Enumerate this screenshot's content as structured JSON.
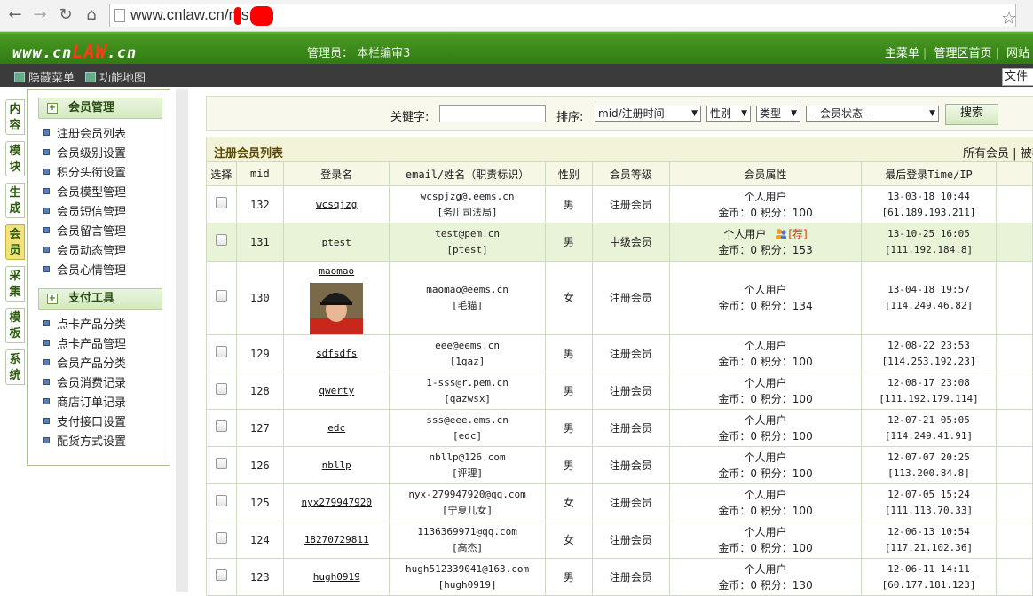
{
  "browser": {
    "url": "www.cnlaw.cn/",
    "url_tail": "ms"
  },
  "header": {
    "logo_prefix": "www.cn",
    "logo_law": "LAW",
    "logo_suffix": ".cn",
    "admin_info": "管理员： 本栏编审3",
    "nav": [
      "主菜单",
      "管理区首页",
      "网站"
    ]
  },
  "toolbar": {
    "hide_menu": "隐藏菜单",
    "function_map": "功能地图",
    "file_select": "文件"
  },
  "vtabs": [
    {
      "label": "内容",
      "active": false
    },
    {
      "label": "模块",
      "active": false
    },
    {
      "label": "生成",
      "active": false
    },
    {
      "label": "会员",
      "active": true
    },
    {
      "label": "采集",
      "active": false
    },
    {
      "label": "模板",
      "active": false
    },
    {
      "label": "系统",
      "active": false
    }
  ],
  "leftmenu": {
    "member_title": "会员管理",
    "member_items": [
      "注册会员列表",
      "会员级别设置",
      "积分头衔设置",
      "会员模型管理",
      "会员短信管理",
      "会员留言管理",
      "会员动态管理",
      "会员心情管理"
    ],
    "payment_title": "支付工具",
    "payment_items": [
      "点卡产品分类",
      "点卡产品管理",
      "会员产品分类",
      "会员消费记录",
      "商店订单记录",
      "支付接口设置",
      "配货方式设置"
    ]
  },
  "search": {
    "keyword_label": "关键字:",
    "keyword_value": "",
    "sort_label": "排序:",
    "sort_value": "mid/注册时间",
    "gender_value": "性别",
    "type_value": "类型",
    "status_value": "—会员状态—",
    "button": "搜索"
  },
  "list": {
    "title": "注册会员列表",
    "filter_all": "所有会员",
    "filter_sep": "|",
    "filter_next": "被荐",
    "columns": [
      "选择",
      "mid",
      "登录名",
      "email/姓名（职责标识）",
      "性别",
      "会员等级",
      "会员属性",
      "最后登录Time/IP"
    ],
    "rows": [
      {
        "mid": "132",
        "login": "wcsqjzg",
        "email": "wcspjzg@.eems.cn",
        "name": "[务川司法局]",
        "gender": "男",
        "level": "注册会员",
        "user_type": "个人用户",
        "points": "金币：0 积分：100",
        "recommended": "",
        "time": "13-03-18 10:44",
        "ip": "[61.189.193.211]",
        "highlight": false,
        "has_avatar": false
      },
      {
        "mid": "131",
        "login": "ptest",
        "email": "test@pem.cn",
        "name": "[ptest]",
        "gender": "男",
        "level": "中级会员",
        "user_type": "个人用户",
        "points": "金币：0 积分：153",
        "recommended": "[荐]",
        "time": "13-10-25 16:05",
        "ip": "[111.192.184.8]",
        "highlight": true,
        "has_avatar": false
      },
      {
        "mid": "130",
        "login": "maomao",
        "email": "maomao@eems.cn",
        "name": "[毛猫]",
        "gender": "女",
        "level": "注册会员",
        "user_type": "个人用户",
        "points": "金币：0 积分：134",
        "recommended": "",
        "time": "13-04-18 19:57",
        "ip": "[114.249.46.82]",
        "highlight": false,
        "has_avatar": true
      },
      {
        "mid": "129",
        "login": "sdfsdfs",
        "email": "eee@eems.cn",
        "name": "[1qaz]",
        "gender": "男",
        "level": "注册会员",
        "user_type": "个人用户",
        "points": "金币：0 积分：100",
        "recommended": "",
        "time": "12-08-22 23:53",
        "ip": "[114.253.192.23]",
        "highlight": false,
        "has_avatar": false
      },
      {
        "mid": "128",
        "login": "qwerty",
        "email": "1-sss@r.pem.cn",
        "name": "[qazwsx]",
        "gender": "男",
        "level": "注册会员",
        "user_type": "个人用户",
        "points": "金币：0 积分：100",
        "recommended": "",
        "time": "12-08-17 23:08",
        "ip": "[111.192.179.114]",
        "highlight": false,
        "has_avatar": false
      },
      {
        "mid": "127",
        "login": "edc",
        "email": "sss@eee.ems.cn",
        "name": "[edc]",
        "gender": "男",
        "level": "注册会员",
        "user_type": "个人用户",
        "points": "金币：0 积分：100",
        "recommended": "",
        "time": "12-07-21 05:05",
        "ip": "[114.249.41.91]",
        "highlight": false,
        "has_avatar": false
      },
      {
        "mid": "126",
        "login": "nbllp",
        "email": "nbllp@126.com",
        "name": "[评理]",
        "gender": "男",
        "level": "注册会员",
        "user_type": "个人用户",
        "points": "金币：0 积分：100",
        "recommended": "",
        "time": "12-07-07 20:25",
        "ip": "[113.200.84.8]",
        "highlight": false,
        "has_avatar": false
      },
      {
        "mid": "125",
        "login": "nyx279947920",
        "email": "nyx-279947920@qq.com",
        "name": "[宁夏儿女]",
        "gender": "女",
        "level": "注册会员",
        "user_type": "个人用户",
        "points": "金币：0 积分：100",
        "recommended": "",
        "time": "12-07-05 15:24",
        "ip": "[111.113.70.33]",
        "highlight": false,
        "has_avatar": false
      },
      {
        "mid": "124",
        "login": "18270729811",
        "email": "1136369971@qq.com",
        "name": "[高杰]",
        "gender": "女",
        "level": "注册会员",
        "user_type": "个人用户",
        "points": "金币：0 积分：100",
        "recommended": "",
        "time": "12-06-13 10:54",
        "ip": "[117.21.102.36]",
        "highlight": false,
        "has_avatar": false
      },
      {
        "mid": "123",
        "login": "hugh0919",
        "email": "hugh512339041@163.com",
        "name": "[hugh0919]",
        "gender": "男",
        "level": "注册会员",
        "user_type": "个人用户",
        "points": "金币：0 积分：130",
        "recommended": "",
        "time": "12-06-11 14:11",
        "ip": "[60.177.181.123]",
        "highlight": false,
        "has_avatar": false
      }
    ]
  },
  "colors": {
    "header_green": "#2f7a12",
    "logo_accent": "#ff3a1a",
    "active_tab": "#f1e27b",
    "row_highlight": "#e9f3d8"
  }
}
